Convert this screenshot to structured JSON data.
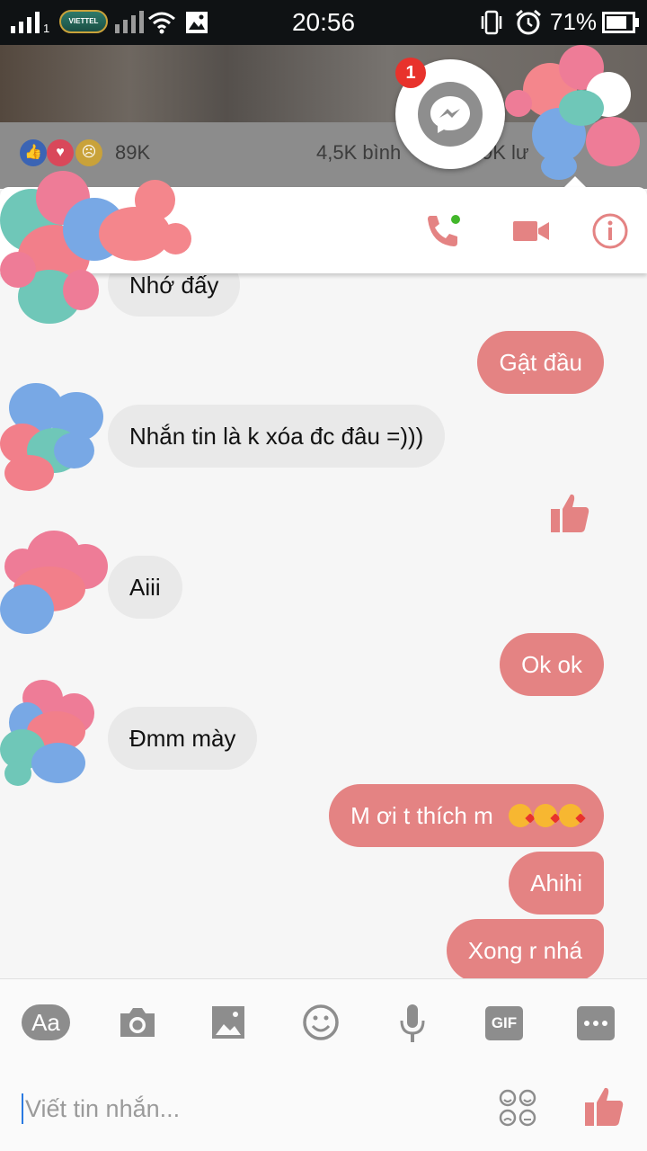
{
  "status_bar": {
    "time": "20:56",
    "battery_percent": "71%",
    "carrier_label": "VIETTEL",
    "sim_slot": "1",
    "icons": [
      "signal-icon",
      "carrier-logo",
      "signal-icon",
      "wifi-icon",
      "gallery-icon",
      "vibrate-icon",
      "alarm-icon",
      "battery-icon"
    ]
  },
  "background_post": {
    "reaction_count": "89K",
    "comments_text": "4,5K bình",
    "shares_text": "9K lư"
  },
  "chat_head": {
    "badge_count": "1",
    "icon": "messenger-icon"
  },
  "header": {
    "call_icon": "phone-icon",
    "video_icon": "video-camera-icon",
    "info_icon": "info-icon",
    "online_color": "#42b72a"
  },
  "messages": [
    {
      "side": "incoming",
      "text": "Nhớ đấy"
    },
    {
      "side": "outgoing",
      "text": "Gật đầu"
    },
    {
      "side": "incoming",
      "text": "Nhắn tin là k xóa đc đâu =)))"
    },
    {
      "side": "outgoing",
      "type": "like",
      "icon": "thumbs-up-icon"
    },
    {
      "side": "incoming",
      "text": "Aiii"
    },
    {
      "side": "outgoing",
      "text": "Ok ok"
    },
    {
      "side": "incoming",
      "text": "Đmm mày"
    },
    {
      "side": "outgoing",
      "text": "M ơi t thích m",
      "emoji": [
        "kissing-face-icon",
        "kissing-face-icon",
        "kissing-face-icon"
      ]
    },
    {
      "side": "outgoing",
      "text": "Ahihi"
    },
    {
      "side": "outgoing",
      "text": "Xong r nhá"
    }
  ],
  "toolbar": {
    "text_format_label": "Aa",
    "gif_label": "GIF",
    "icons": [
      "text-format-icon",
      "camera-icon",
      "image-icon",
      "emoji-icon",
      "microphone-icon",
      "gif-icon",
      "more-icon"
    ]
  },
  "composer": {
    "placeholder": "Viết tin nhắn...",
    "sticker_icon": "stickers-icon",
    "send_icon": "thumbs-up-icon"
  },
  "colors": {
    "accent": "#e48383",
    "incoming_bubble": "#e9e9e9",
    "status_bar": "#0f1214"
  }
}
